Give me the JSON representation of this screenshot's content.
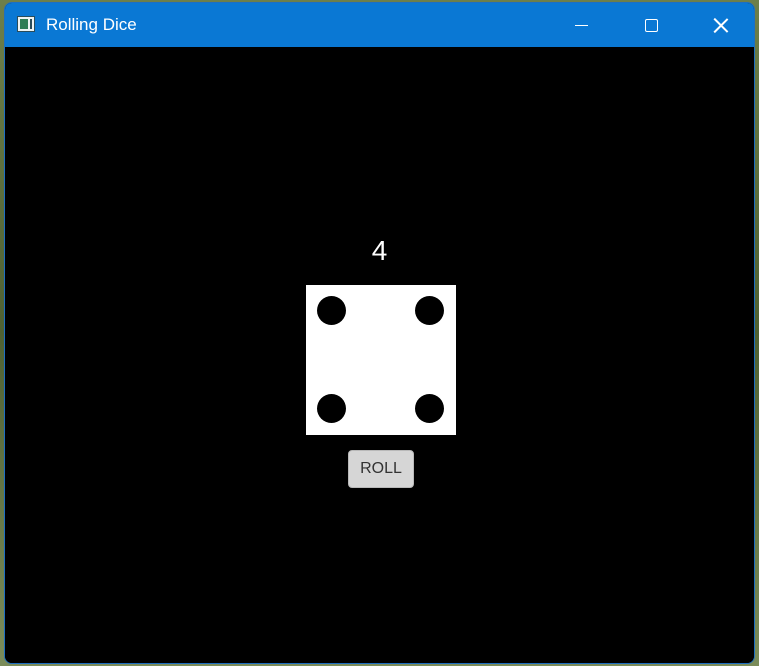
{
  "window": {
    "title": "Rolling Dice",
    "controls": [
      "minimize",
      "maximize",
      "close"
    ]
  },
  "dice": {
    "value": "4",
    "face_pips": 4
  },
  "actions": {
    "roll_label": "ROLL"
  },
  "colors": {
    "titlebar": "#0a78d4",
    "background": "#000000",
    "die_face": "#ffffff",
    "pip": "#000000",
    "button": "#d6d6d6"
  },
  "icons": {
    "app": "app-window-icon",
    "minimize": "minimize-icon",
    "maximize": "maximize-icon",
    "close": "close-icon"
  }
}
